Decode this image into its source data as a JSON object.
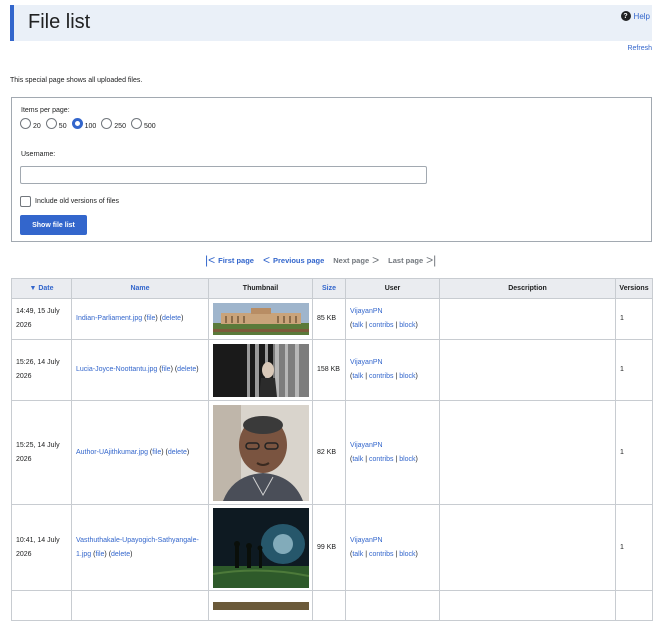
{
  "page": {
    "title": "File list",
    "help": "Help",
    "refresh": "Refresh",
    "intro": "This special page shows all uploaded files."
  },
  "form": {
    "items_label": "Items per page:",
    "options": [
      "20",
      "50",
      "100",
      "250",
      "500"
    ],
    "selected_option": "100",
    "username_label": "Username:",
    "username_value": "",
    "old_versions_label": "Include old versions of files",
    "old_versions_checked": false,
    "submit": "Show file list"
  },
  "pager": {
    "first": "First page",
    "previous": "Previous page",
    "next": "Next page",
    "last": "Last page"
  },
  "table": {
    "headers": {
      "date": "▼ Date",
      "name": "Name",
      "thumbnail": "Thumbnail",
      "size": "Size",
      "user": "User",
      "description": "Description",
      "versions": "Versions"
    },
    "rows": [
      {
        "date": "14:49, 15 July 2026",
        "name": "Indian-Parliament.jpg",
        "file": "file",
        "delete": "delete",
        "size": "85 KB",
        "user": "VijayanPN",
        "talk": "talk",
        "contribs": "contribs",
        "block": "block",
        "description": "",
        "versions": "1"
      },
      {
        "date": "15:26, 14 July 2026",
        "name": "Lucia-Joyce-Noottantu.jpg",
        "file": "file",
        "delete": "delete",
        "size": "158 KB",
        "user": "VijayanPN",
        "talk": "talk",
        "contribs": "contribs",
        "block": "block",
        "description": "",
        "versions": "1"
      },
      {
        "date": "15:25, 14 July 2026",
        "name": "Author-UAjithkumar.jpg",
        "file": "file",
        "delete": "delete",
        "size": "82 KB",
        "user": "VijayanPN",
        "talk": "talk",
        "contribs": "contribs",
        "block": "block",
        "description": "",
        "versions": "1"
      },
      {
        "date": "10:41, 14 July 2026",
        "name": "Vasthuthakale-Upayogich-Sathyangale-1.jpg",
        "file": "file",
        "delete": "delete",
        "size": "99 KB",
        "user": "VijayanPN",
        "talk": "talk",
        "contribs": "contribs",
        "block": "block",
        "description": "",
        "versions": "1"
      }
    ]
  },
  "icons": {
    "help": "help-icon",
    "first": "first-page-icon",
    "previous": "chevron-left-icon",
    "next": "chevron-right-icon",
    "last": "last-page-icon"
  }
}
